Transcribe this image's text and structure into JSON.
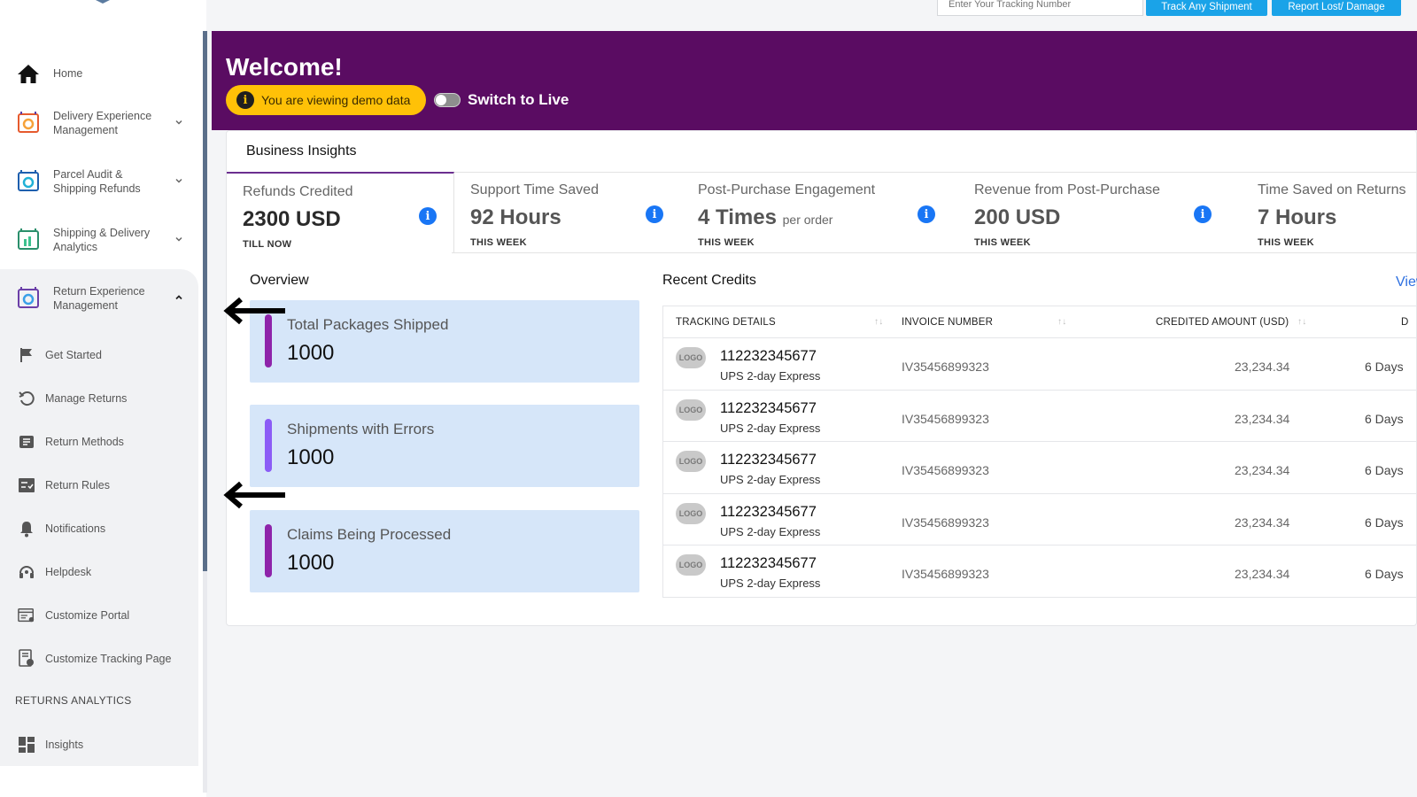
{
  "sidebar": {
    "nav": [
      {
        "label": "Home",
        "icon": "home-icon"
      },
      {
        "label": "Delivery Experience Management",
        "icon": "delivery-experience-icon"
      },
      {
        "label": "Parcel Audit & Shipping Refunds",
        "icon": "parcel-audit-icon"
      },
      {
        "label": "Shipping & Delivery Analytics",
        "icon": "shipping-analytics-icon"
      },
      {
        "label": "Return Experience Management",
        "icon": "return-experience-icon"
      }
    ],
    "sub": [
      {
        "label": "Get Started",
        "icon": "flag-icon"
      },
      {
        "label": "Manage Returns",
        "icon": "refresh-icon"
      },
      {
        "label": "Return Methods",
        "icon": "list-icon"
      },
      {
        "label": "Return Rules",
        "icon": "checklist-icon"
      },
      {
        "label": "Notifications",
        "icon": "bell-icon"
      },
      {
        "label": "Helpdesk",
        "icon": "headset-icon"
      },
      {
        "label": "Customize Portal",
        "icon": "portal-icon"
      },
      {
        "label": "Customize Tracking Page",
        "icon": "tracking-page-icon"
      }
    ],
    "section_title": "RETURNS ANALYTICS",
    "analytics": [
      {
        "label": "Insights",
        "icon": "grid-icon"
      }
    ]
  },
  "topbar": {
    "tracking_placeholder": "Enter Your Tracking Number",
    "track_btn": "Track Any Shipment",
    "report_btn": "Report Lost/ Damage"
  },
  "banner": {
    "welcome": "Welcome!",
    "demo_text": "You are viewing demo data",
    "switch_label": "Switch to Live"
  },
  "insights": {
    "title": "Business Insights",
    "metrics": [
      {
        "title": "Refunds Credited",
        "value": "2300 USD",
        "suffix": "",
        "sub": "TILL NOW"
      },
      {
        "title": "Support Time Saved",
        "value": "92 Hours",
        "suffix": "",
        "sub": "THIS WEEK"
      },
      {
        "title": "Post-Purchase Engagement",
        "value": "4 Times",
        "suffix": "per order",
        "sub": "THIS WEEK"
      },
      {
        "title": "Revenue from Post-Purchase",
        "value": "200 USD",
        "suffix": "",
        "sub": "THIS WEEK"
      },
      {
        "title": "Time Saved on Returns",
        "value": "7 Hours",
        "suffix": "",
        "sub": "THIS WEEK"
      }
    ]
  },
  "overview": {
    "title": "Overview",
    "items": [
      {
        "label": "Total Packages Shipped",
        "value": "1000",
        "color": "#8e24aa"
      },
      {
        "label": "Shipments with Errors",
        "value": "1000",
        "color": "#8b5cf6"
      },
      {
        "label": "Claims Being Processed",
        "value": "1000",
        "color": "#8e24aa"
      }
    ]
  },
  "recent_credits": {
    "title": "Recent Credits",
    "view_link": "View",
    "headers": [
      "TRACKING DETAILS",
      "INVOICE NUMBER",
      "CREDITED AMOUNT (USD)",
      "D"
    ],
    "rows": [
      {
        "logo": "LOGO",
        "tracking": "112232345677",
        "carrier": "UPS 2-day Express",
        "invoice": "IV35456899323",
        "amount": "23,234.34",
        "days": "6 Days"
      },
      {
        "logo": "LOGO",
        "tracking": "112232345677",
        "carrier": "UPS 2-day Express",
        "invoice": "IV35456899323",
        "amount": "23,234.34",
        "days": "6 Days"
      },
      {
        "logo": "LOGO",
        "tracking": "112232345677",
        "carrier": "UPS 2-day Express",
        "invoice": "IV35456899323",
        "amount": "23,234.34",
        "days": "6 Days"
      },
      {
        "logo": "LOGO",
        "tracking": "112232345677",
        "carrier": "UPS 2-day Express",
        "invoice": "IV35456899323",
        "amount": "23,234.34",
        "days": "6 Days"
      },
      {
        "logo": "LOGO",
        "tracking": "112232345677",
        "carrier": "UPS 2-day Express",
        "invoice": "IV35456899323",
        "amount": "23,234.34",
        "days": "6 Days"
      }
    ]
  },
  "colors": {
    "banner": "#5a0c62",
    "accent_blue": "#1aa3e8",
    "info_blue": "#1976f5",
    "demo_yellow": "#ffc107"
  }
}
